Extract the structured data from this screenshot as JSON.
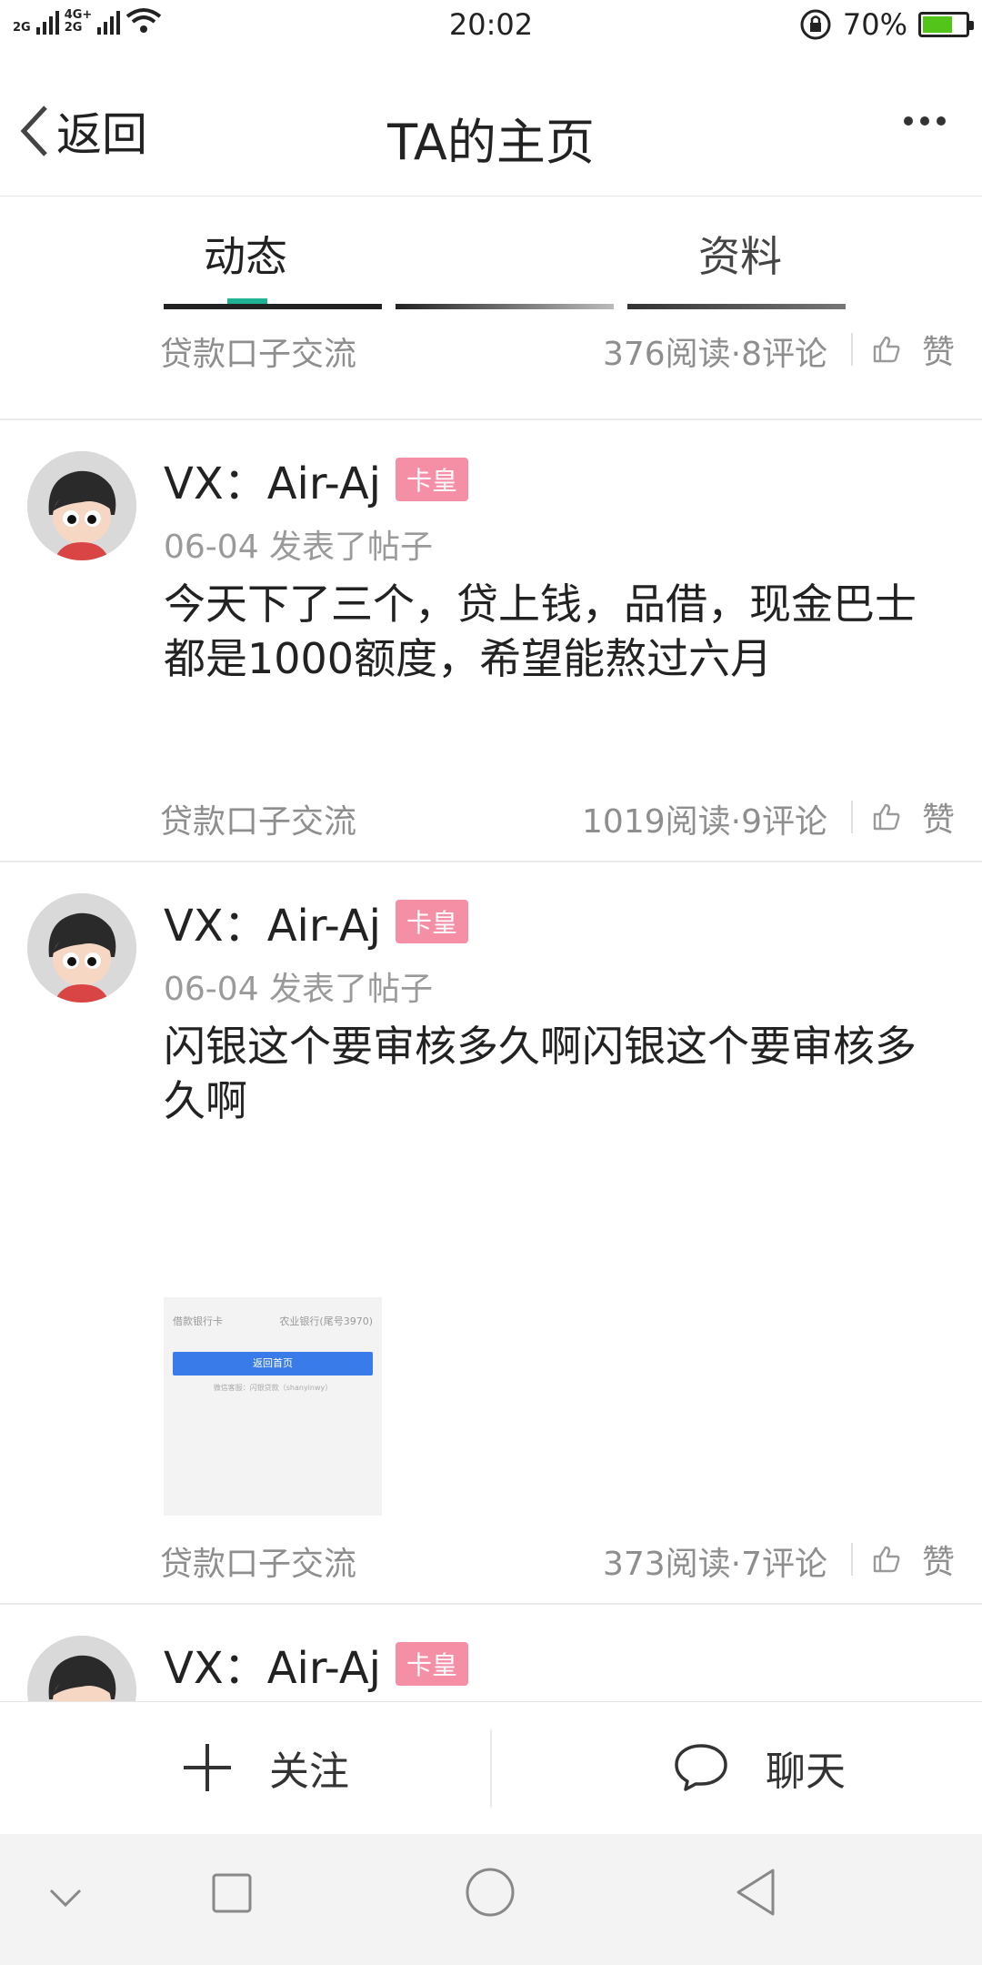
{
  "status_bar": {
    "net1": "2G",
    "net2_top": "4G+",
    "net2_bottom": "2G",
    "time": "20:02",
    "battery_pct": "70%",
    "battery_level": 0.7
  },
  "nav": {
    "back_label": "返回",
    "title": "TA的主页"
  },
  "tabs": [
    {
      "label": "动态",
      "active": true
    },
    {
      "label": "资料",
      "active": false
    }
  ],
  "colors": {
    "accent": "#1fb394",
    "badge": "#f58fa6",
    "meta": "#8e8e8e"
  },
  "top_meta": {
    "tag": "贷款口子交流",
    "stats": "376阅读·8评论",
    "like": "赞"
  },
  "posts": [
    {
      "author": "VX：Air-Aj",
      "badge": "卡皇",
      "date_action": "06-04 发表了帖子",
      "content": "今天下了三个，贷上钱，品借，现金巴士都是1000额度，希望能熬过六月",
      "tag": "贷款口子交流",
      "stats": "1019阅读·9评论",
      "like": "赞"
    },
    {
      "author": "VX：Air-Aj",
      "badge": "卡皇",
      "date_action": "06-04 发表了帖子",
      "content": "闪银这个要审核多久啊闪银这个要审核多久啊",
      "image": {
        "row_label": "借款银行卡",
        "row_value": "农业银行(尾号3970)",
        "button": "返回首页",
        "note": "微信客服：闪银贷款（shanyinwy）"
      },
      "tag": "贷款口子交流",
      "stats": "373阅读·7评论",
      "like": "赞"
    },
    {
      "author": "VX：Air-Aj",
      "badge": "卡皇"
    }
  ],
  "bottom_bar": {
    "follow": "关注",
    "chat": "聊天"
  }
}
